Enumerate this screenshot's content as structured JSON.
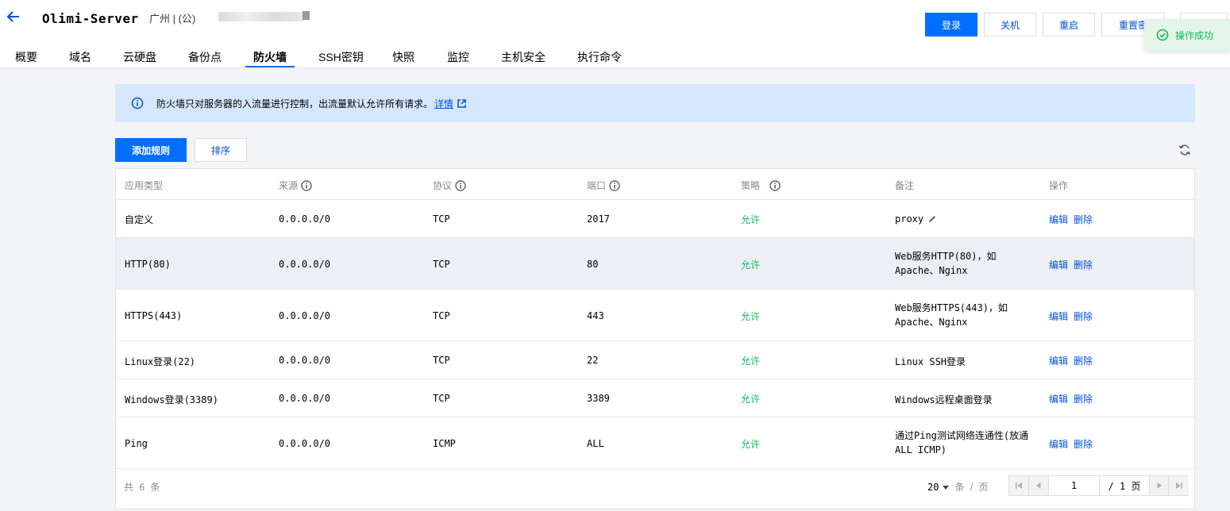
{
  "header": {
    "server_name": "Olimi-Server",
    "region": "广州 | (公)",
    "buttons": {
      "login": "登录",
      "shutdown": "关机",
      "restart": "重启",
      "reset_password": "重置密"
    }
  },
  "toast": {
    "text": "操作成功"
  },
  "tabs": [
    {
      "label": "概要"
    },
    {
      "label": "域名"
    },
    {
      "label": "云硬盘"
    },
    {
      "label": "备份点"
    },
    {
      "label": "防火墙",
      "active": true
    },
    {
      "label": "SSH密钥"
    },
    {
      "label": "快照"
    },
    {
      "label": "监控"
    },
    {
      "label": "主机安全"
    },
    {
      "label": "执行命令"
    }
  ],
  "banner": {
    "text": "防火墙只对服务器的入流量进行控制，出流量默认允许所有请求。",
    "link": "详情"
  },
  "toolbar": {
    "add": "添加规则",
    "sort": "排序"
  },
  "table": {
    "columns": [
      "应用类型",
      "来源",
      "协议",
      "端口",
      "策略",
      "备注",
      "操作"
    ],
    "rows": [
      {
        "type": "自定义",
        "source": "0.0.0.0/0",
        "protocol": "TCP",
        "port": "2017",
        "policy": "允许",
        "note": "proxy",
        "edit": "编辑",
        "delete": "删除"
      },
      {
        "type": "HTTP(80)",
        "source": "0.0.0.0/0",
        "protocol": "TCP",
        "port": "80",
        "policy": "允许",
        "note": "Web服务HTTP(80)，如Apache、Nginx",
        "edit": "编辑",
        "delete": "删除"
      },
      {
        "type": "HTTPS(443)",
        "source": "0.0.0.0/0",
        "protocol": "TCP",
        "port": "443",
        "policy": "允许",
        "note": "Web服务HTTPS(443)，如Apache、Nginx",
        "edit": "编辑",
        "delete": "删除"
      },
      {
        "type": "Linux登录(22)",
        "source": "0.0.0.0/0",
        "protocol": "TCP",
        "port": "22",
        "policy": "允许",
        "note": "Linux SSH登录",
        "edit": "编辑",
        "delete": "删除"
      },
      {
        "type": "Windows登录(3389)",
        "source": "0.0.0.0/0",
        "protocol": "TCP",
        "port": "3389",
        "policy": "允许",
        "note": "Windows远程桌面登录",
        "edit": "编辑",
        "delete": "删除"
      },
      {
        "type": "Ping",
        "source": "0.0.0.0/0",
        "protocol": "ICMP",
        "port": "ALL",
        "policy": "允许",
        "note": "通过Ping测试网络连通性(放通ALL ICMP)",
        "edit": "编辑",
        "delete": "删除"
      }
    ]
  },
  "footer": {
    "total": "共 6 条",
    "page_size": "20",
    "page_size_unit": "条 / 页",
    "current_page": "1",
    "total_pages": "/ 1 页"
  },
  "colors": {
    "primary": "#006eff",
    "link": "#0052d9",
    "success": "#0abf5b",
    "banner_bg": "#d5e7ff"
  }
}
